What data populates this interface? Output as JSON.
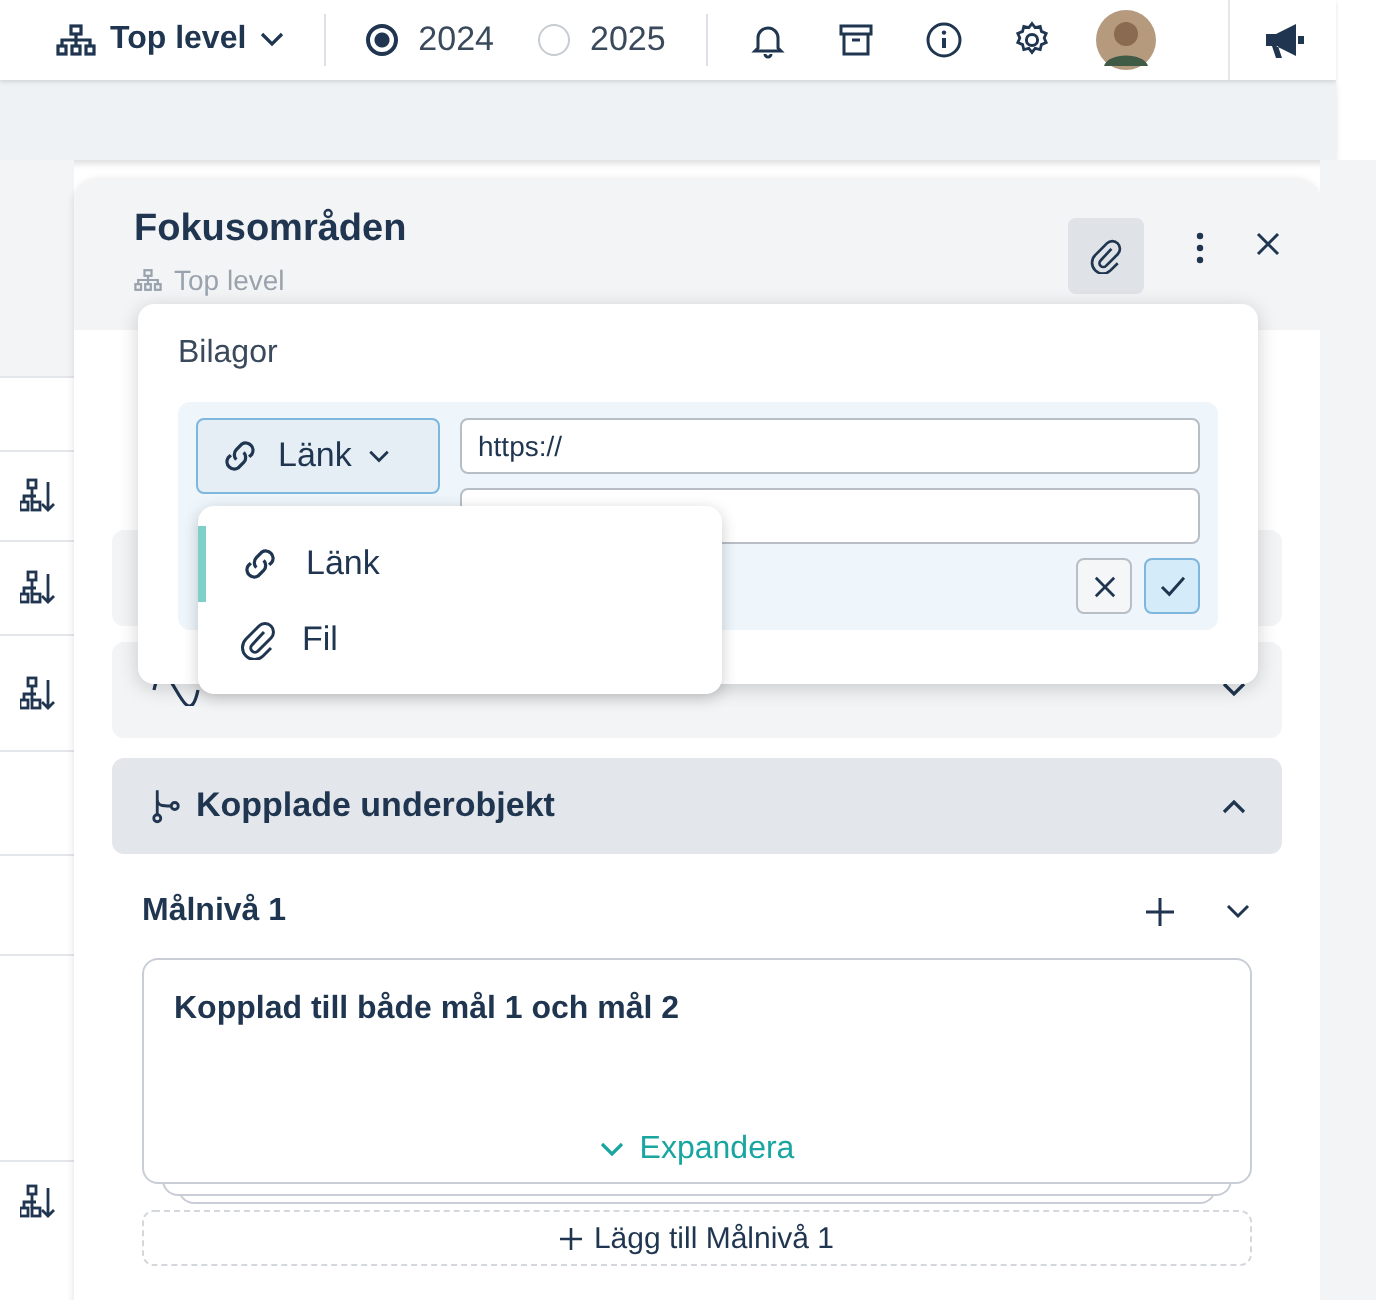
{
  "topbar": {
    "level": "Top level",
    "years": [
      {
        "label": "2024",
        "selected": true
      },
      {
        "label": "2025",
        "selected": false
      }
    ]
  },
  "panel": {
    "title": "Fokusområden",
    "subtitle": "Top level"
  },
  "attachments": {
    "title": "Bilagor",
    "type": "Länk",
    "url": "https://",
    "menu": [
      {
        "label": "Länk",
        "selected": true
      },
      {
        "label": "Fil",
        "selected": false
      }
    ]
  },
  "sections": [
    {
      "expanded": false
    },
    {
      "title": "Kopplade underobjekt",
      "expanded": true
    }
  ],
  "group": {
    "title": "Målnivå 1",
    "card": "Kopplad till både mål 1 och mål 2",
    "expand": "Expandera",
    "add": "Lägg till Målnivå 1"
  }
}
